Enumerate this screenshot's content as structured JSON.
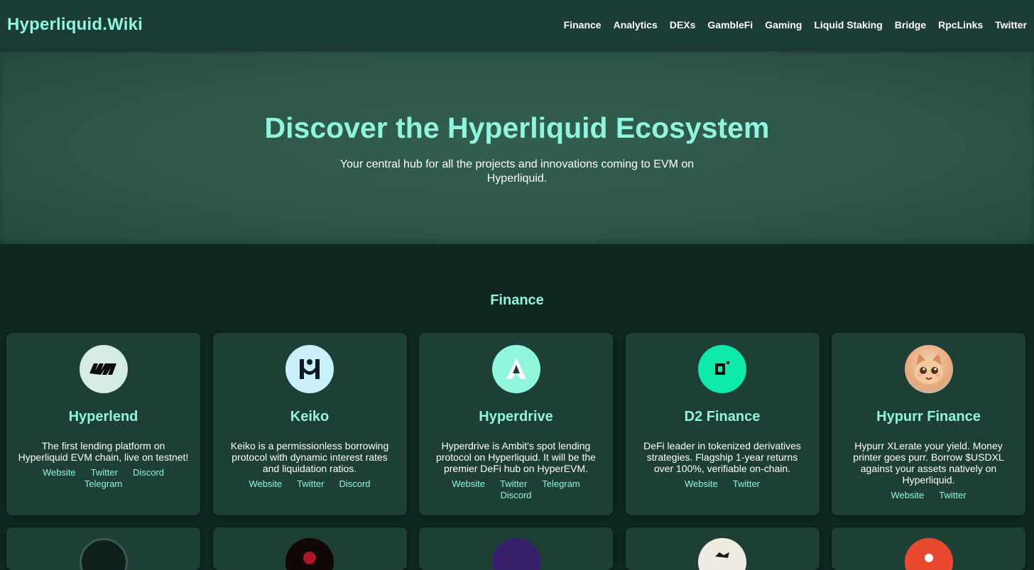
{
  "nav": {
    "brand": "Hyperliquid.Wiki",
    "links": [
      "Finance",
      "Analytics",
      "DEXs",
      "GambleFi",
      "Gaming",
      "Liquid Staking",
      "Bridge",
      "RpcLinks",
      "Twitter"
    ]
  },
  "hero": {
    "title": "Discover the Hyperliquid Ecosystem",
    "subtitle": "Your central hub for all the projects and innovations coming to EVM on Hyperliquid."
  },
  "finance": {
    "title": "Finance",
    "cards": [
      {
        "name": "Hyperlend",
        "description": "The first lending platform on Hyperliquid EVM chain, live on testnet!",
        "links": [
          "Website",
          "Twitter",
          "Discord",
          "Telegram"
        ],
        "logo_icon": "hyperlend-logo-icon"
      },
      {
        "name": "Keiko",
        "description": "Keiko is a permissionless borrowing protocol with dynamic interest rates and liquidation ratios.",
        "links": [
          "Website",
          "Twitter",
          "Discord"
        ],
        "logo_icon": "keiko-logo-icon"
      },
      {
        "name": "Hyperdrive",
        "description": "Hyperdrive is Ambit's spot lending protocol on Hyperliquid. It will be the premier DeFi hub on HyperEVM.",
        "links": [
          "Website",
          "Twitter",
          "Telegram",
          "Discord"
        ],
        "logo_icon": "hyperdrive-logo-icon"
      },
      {
        "name": "D2 Finance",
        "description": "DeFi leader in tokenized derivatives strategies. Flagship 1-year returns over 100%, verifiable on-chain.",
        "links": [
          "Website",
          "Twitter"
        ],
        "logo_icon": "d2-finance-logo-icon"
      },
      {
        "name": "Hypurr Finance",
        "description": "Hypurr XLerate your yield. Money printer goes purr. Borrow $USDXL against your assets natively on Hyperliquid.",
        "links": [
          "Website",
          "Twitter"
        ],
        "logo_icon": "hypurr-cat-logo-icon"
      }
    ]
  },
  "colors": {
    "accent": "#8ff5dc",
    "navbar": "#1c3d35",
    "hero": "#2d5748",
    "page": "#0d2620",
    "card": "#1d3f36"
  }
}
